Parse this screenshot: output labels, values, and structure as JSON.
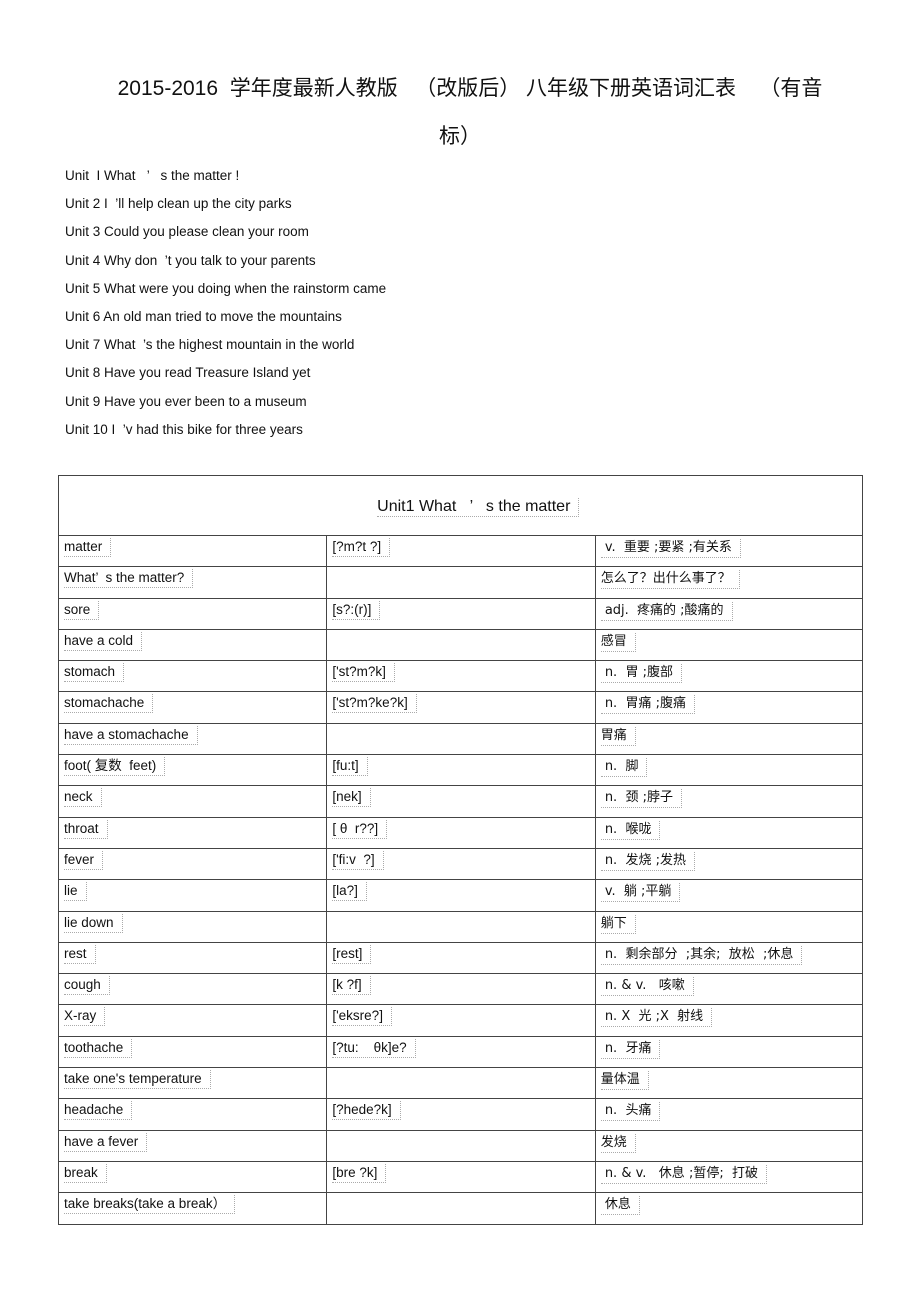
{
  "document": {
    "title_line1": "2015-2016  学年度最新人教版   （改版后） 八年级下册英语词汇表    （有音",
    "title_line2": "标）",
    "units": [
      "Unit  I What   ’   s the matter !",
      "Unit 2 I  ’ll help clean up the city parks",
      "Unit 3 Could you please clean your room",
      "Unit 4 Why don  ’t you talk to your parents",
      "Unit 5 What were you doing when the rainstorm came",
      "Unit 6 An old man tried to move the mountains",
      "Unit 7 What  ’s the highest mountain in the world",
      "Unit 8 Have you read Treasure Island yet",
      "Unit 9 Have you ever been to a museum",
      "Unit 10 I  ’v had this bike for three years"
    ],
    "table": {
      "heading": "Unit1 What   ’   s the matter",
      "rows": [
        {
          "word": "matter",
          "phonetic": "[?m?t ?]",
          "meaning": " v.  重要 ;要紧 ;有关系"
        },
        {
          "word": "What’  s the matter?",
          "phonetic": "",
          "meaning": "怎么了？出什么事了？"
        },
        {
          "word": "sore",
          "phonetic": "[s?:(r)]",
          "meaning": " adj.  疼痛的 ;酸痛的"
        },
        {
          "word": "have a cold",
          "phonetic": "",
          "meaning": "感冒"
        },
        {
          "word": "stomach",
          "phonetic": "['st?m?k]",
          "meaning": " n.  胃 ;腹部"
        },
        {
          "word": "stomachache",
          "phonetic": "['st?m?ke?k]",
          "meaning": " n.  胃痛 ;腹痛"
        },
        {
          "word": "have a stomachache",
          "phonetic": "",
          "meaning": "胃痛"
        },
        {
          "word": "foot( 复数  feet)",
          "phonetic": "[fu:t]",
          "meaning": " n.  脚"
        },
        {
          "word": "neck",
          "phonetic": "[nek]",
          "meaning": " n.  颈 ;脖子"
        },
        {
          "word": "throat",
          "phonetic": "[ θ  r??]",
          "meaning": " n.  喉咙"
        },
        {
          "word": "fever",
          "phonetic": "['fi:v  ?]",
          "meaning": " n.  发烧 ;发热"
        },
        {
          "word": "lie",
          "phonetic": "[la?]",
          "meaning": " v.  躺 ;平躺"
        },
        {
          "word": "lie down",
          "phonetic": "",
          "meaning": "躺下"
        },
        {
          "word": "rest",
          "phonetic": "[rest]",
          "meaning": " n.  剩余部分  ;其余;  放松  ;休息"
        },
        {
          "word": "cough",
          "phonetic": "[k ?f]",
          "meaning": " n. & v.   咳嗽"
        },
        {
          "word": "X-ray",
          "phonetic": "['eksre?]",
          "meaning": " n. X  光 ;X  射线"
        },
        {
          "word": "toothache",
          "phonetic": "[?tu:    θk]e?",
          "meaning": " n.  牙痛"
        },
        {
          "word": "take one's temperature",
          "phonetic": "",
          "meaning": "量体温"
        },
        {
          "word": "headache",
          "phonetic": "[?hede?k]",
          "meaning": " n.  头痛"
        },
        {
          "word": "have a fever",
          "phonetic": "",
          "meaning": "发烧"
        },
        {
          "word": "break",
          "phonetic": "[bre ?k]",
          "meaning": " n. & v.   休息 ;暂停;  打破"
        },
        {
          "word": "take breaks(take a break）",
          "phonetic": "",
          "meaning": " 休息"
        }
      ]
    }
  }
}
